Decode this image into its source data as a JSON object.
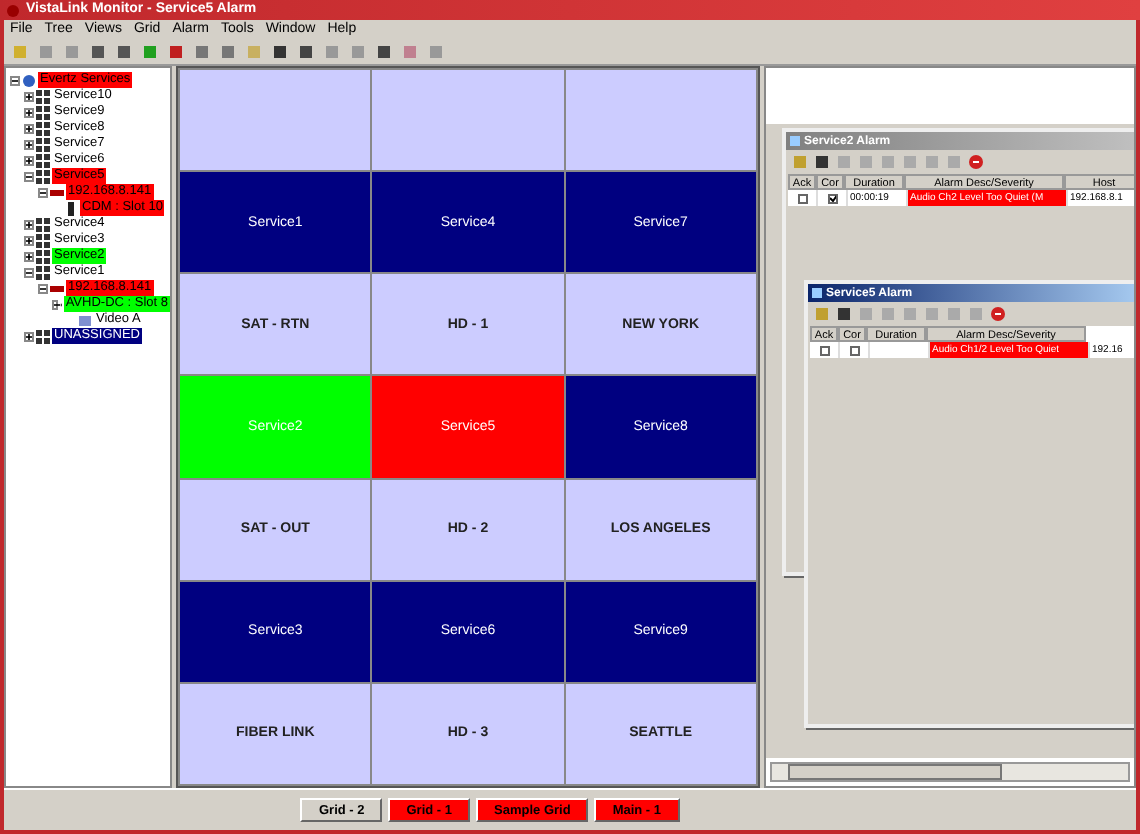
{
  "window": {
    "title": "VistaLink Monitor - Service5 Alarm"
  },
  "menu": [
    "File",
    "Tree",
    "Views",
    "Grid",
    "Alarm",
    "Tools",
    "Window",
    "Help"
  ],
  "tree": [
    {
      "label": "Evertz Services",
      "kind": "root",
      "color": "#ff0000",
      "expanded": true,
      "children": [
        {
          "label": "Service10",
          "kind": "service",
          "expanded": false
        },
        {
          "label": "Service9",
          "kind": "service",
          "expanded": false
        },
        {
          "label": "Service8",
          "kind": "service",
          "expanded": false
        },
        {
          "label": "Service7",
          "kind": "service",
          "expanded": false
        },
        {
          "label": "Service6",
          "kind": "service",
          "expanded": false
        },
        {
          "label": "Service5",
          "kind": "service",
          "color": "#ff0000",
          "expanded": true,
          "children": [
            {
              "label": "192.168.8.141",
              "kind": "device",
              "color": "#ff0000",
              "expanded": true,
              "children": [
                {
                  "label": "CDM : Slot 10",
                  "kind": "card",
                  "color": "#ff0000"
                }
              ]
            }
          ]
        },
        {
          "label": "Service4",
          "kind": "service",
          "expanded": false
        },
        {
          "label": "Service3",
          "kind": "service",
          "expanded": false
        },
        {
          "label": "Service2",
          "kind": "service",
          "color": "#00ff00",
          "expanded": false
        },
        {
          "label": "Service1",
          "kind": "service",
          "expanded": true,
          "children": [
            {
              "label": "192.168.8.141",
              "kind": "device",
              "color": "#ff0000",
              "expanded": true,
              "children": [
                {
                  "label": "AVHD-DC : Slot 8",
                  "kind": "card",
                  "color": "#00ff00",
                  "expanded": true,
                  "children": [
                    {
                      "label": "Video A",
                      "kind": "signal"
                    }
                  ]
                }
              ]
            }
          ]
        },
        {
          "label": "UNASSIGNED",
          "kind": "service",
          "color": "#000080",
          "expanded": false
        }
      ]
    }
  ],
  "grid": {
    "tiles": [
      {
        "kind": "label"
      },
      {
        "kind": "label"
      },
      {
        "kind": "label"
      },
      {
        "kind": "service",
        "text": "Service1",
        "color": "#000080"
      },
      {
        "kind": "service",
        "text": "Service4",
        "color": "#000080"
      },
      {
        "kind": "service",
        "text": "Service7",
        "color": "#000080"
      },
      {
        "kind": "label",
        "text": "SAT - RTN"
      },
      {
        "kind": "label",
        "text": "HD - 1"
      },
      {
        "kind": "label",
        "text": "NEW YORK"
      },
      {
        "kind": "service",
        "text": "Service2",
        "color": "#00ff00"
      },
      {
        "kind": "service",
        "text": "Service5",
        "color": "#ff0000"
      },
      {
        "kind": "service",
        "text": "Service8",
        "color": "#000080"
      },
      {
        "kind": "label",
        "text": "SAT - OUT"
      },
      {
        "kind": "label",
        "text": "HD - 2"
      },
      {
        "kind": "label",
        "text": "LOS ANGELES"
      },
      {
        "kind": "service",
        "text": "Service3",
        "color": "#000080"
      },
      {
        "kind": "service",
        "text": "Service6",
        "color": "#000080"
      },
      {
        "kind": "service",
        "text": "Service9",
        "color": "#000080"
      },
      {
        "kind": "label",
        "text": "FIBER LINK"
      },
      {
        "kind": "label",
        "text": "HD - 3"
      },
      {
        "kind": "label",
        "text": "SEATTLE"
      }
    ]
  },
  "alarm_windows": [
    {
      "title": "Service2 Alarm",
      "active": false,
      "columns": [
        "Ack",
        "Cor",
        "Duration",
        "Alarm Desc/Severity",
        "Host"
      ],
      "rows": [
        {
          "ack": false,
          "cor": true,
          "duration": "00:00:19",
          "desc": "Audio Ch2 Level Too Quiet (M",
          "host": "192.168.8.1"
        }
      ]
    },
    {
      "title": "Service5 Alarm",
      "active": true,
      "columns": [
        "Ack",
        "Cor",
        "Duration",
        "Alarm Desc/Severity"
      ],
      "rows": [
        {
          "ack": false,
          "cor": false,
          "desc": "Audio Ch1/2 Level Too Quiet",
          "host": "192.16"
        }
      ]
    }
  ],
  "grid_tabs": [
    {
      "label": "Grid - 2",
      "alarm": false
    },
    {
      "label": "Grid - 1",
      "alarm": true
    },
    {
      "label": "Sample Grid",
      "alarm": true
    },
    {
      "label": "Main - 1",
      "alarm": true
    }
  ]
}
